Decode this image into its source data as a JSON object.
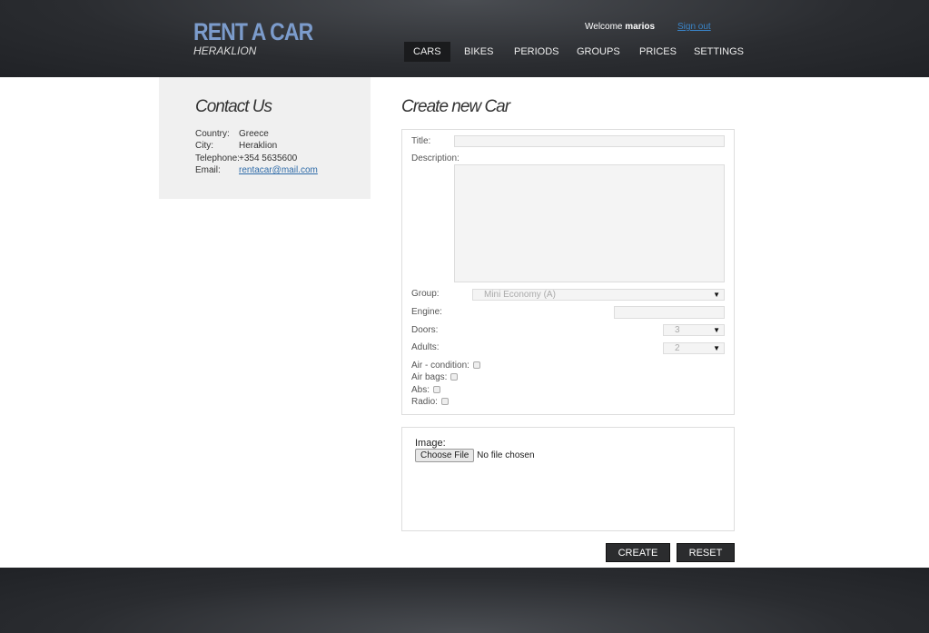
{
  "header": {
    "logo": "RENT A CAR",
    "city": "HERAKLION",
    "welcome": "Welcome",
    "user": "marios",
    "signout": "Sign out",
    "nav": [
      "CARS",
      "BIKES",
      "PERIODS",
      "GROUPS",
      "PRICES",
      "SETTINGS"
    ],
    "active": "CARS"
  },
  "contact": {
    "title": "Contact Us",
    "rows": [
      {
        "k": "Country:",
        "v": "Greece"
      },
      {
        "k": "City:",
        "v": "Heraklion"
      },
      {
        "k": "Telephone:",
        "v": "+354 5635600"
      },
      {
        "k": "Email:",
        "v": "rentacar@mail.com"
      }
    ]
  },
  "form": {
    "title": "Create new Car",
    "title_label": "Title:",
    "description_label": "Description:",
    "group_label": "Group:",
    "group_value": "Mini Economy (A)",
    "engine_label": "Engine:",
    "doors_label": "Doors:",
    "doors_value": "3",
    "adults_label": "Adults:",
    "adults_value": "2",
    "air_label": "Air - condition:",
    "airbags_label": "Air bags:",
    "abs_label": "Abs:",
    "radio_label": "Radio:",
    "image_label": "Image:",
    "choose_file": "Choose File",
    "no_file": "No file chosen",
    "create": "CREATE",
    "reset": "RESET"
  }
}
